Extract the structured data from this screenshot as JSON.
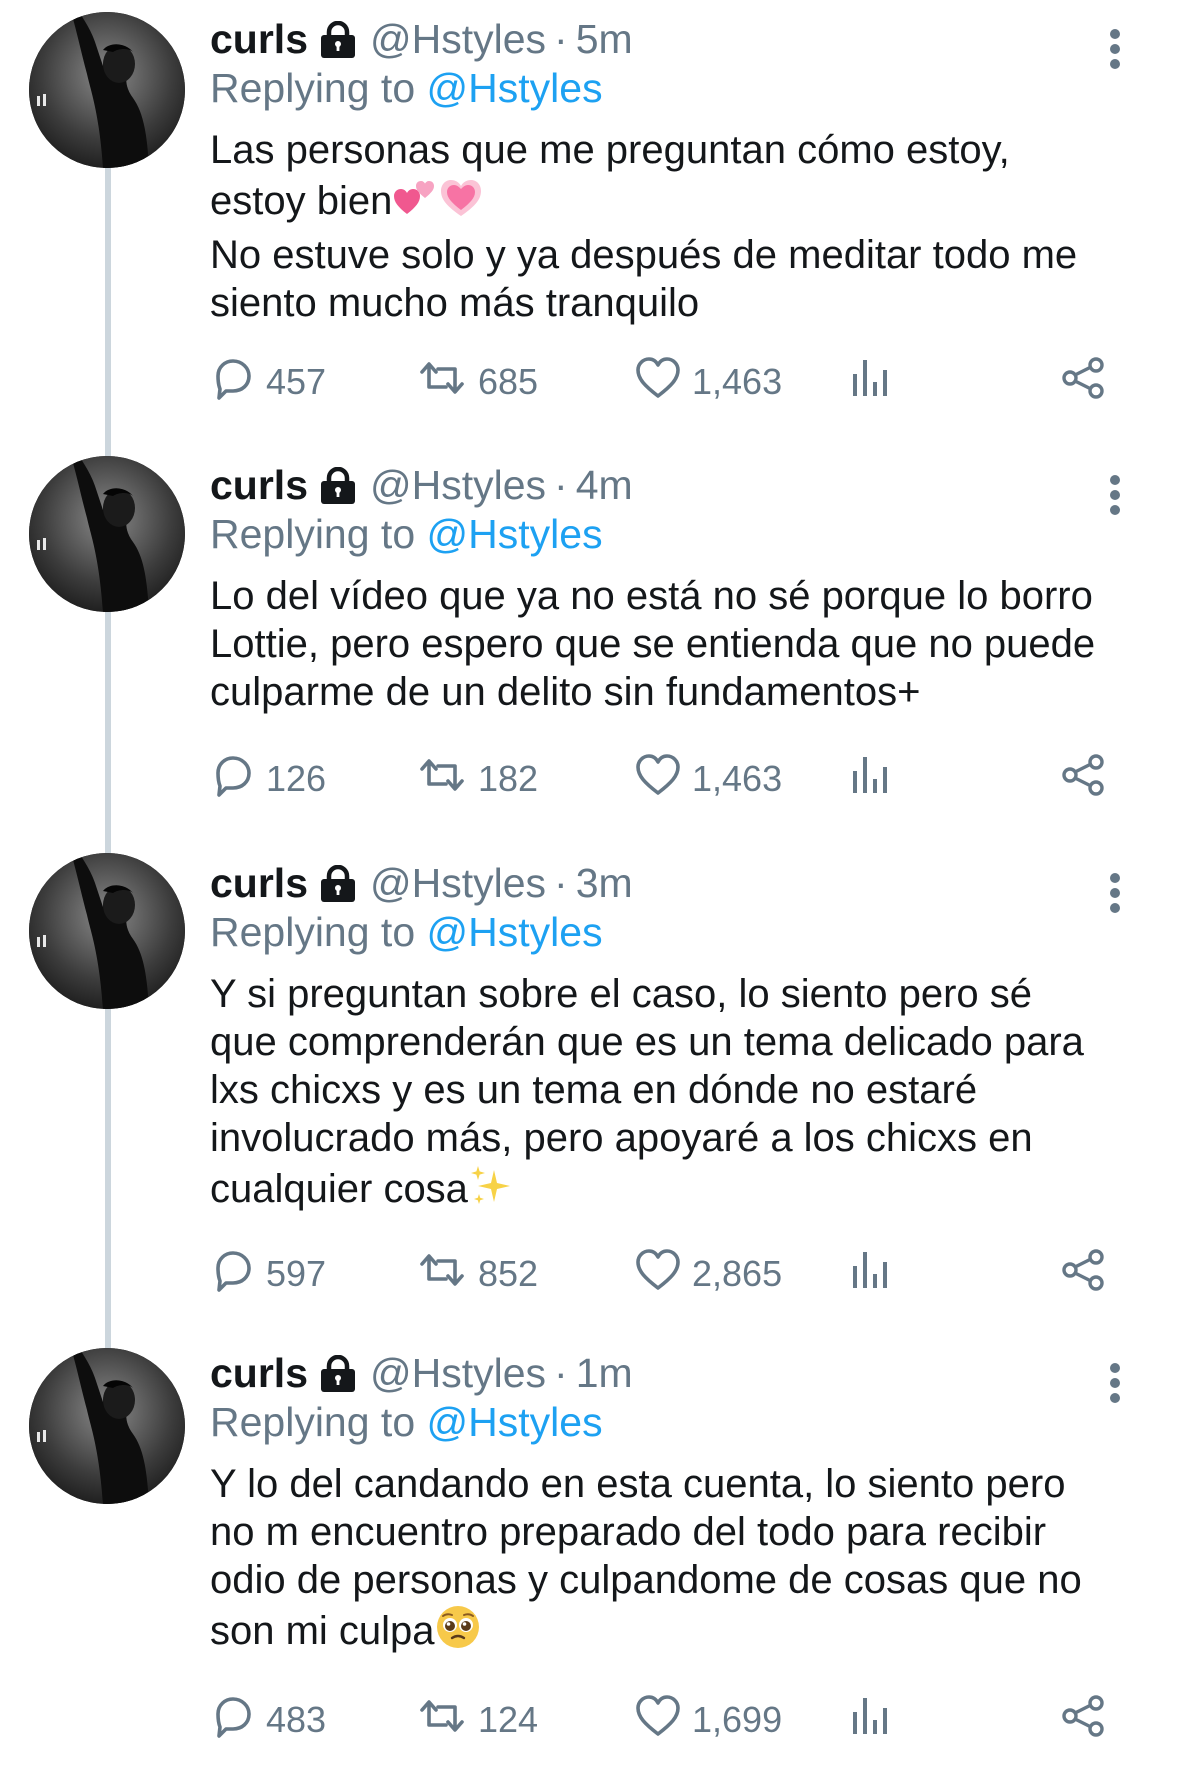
{
  "tweets": [
    {
      "name": "curls",
      "handle": "@Hstyles",
      "separator": "·",
      "time": "5m",
      "replying_prefix": "Replying to",
      "replying_to": "@Hstyles",
      "lines": [
        "Las personas que me preguntan cómo estoy,",
        "estoy bien",
        "No estuve solo y ya después de meditar todo me",
        "siento mucho más tranquilo"
      ],
      "emoji_after_line": {
        "1": [
          "two-hearts-emoji",
          "growing-heart-emoji"
        ]
      },
      "replies": "457",
      "retweets": "685",
      "likes": "1,463"
    },
    {
      "name": "curls",
      "handle": "@Hstyles",
      "separator": "·",
      "time": "4m",
      "replying_prefix": "Replying to",
      "replying_to": "@Hstyles",
      "lines": [
        "Lo del vídeo que ya no está no sé porque lo borro",
        "Lottie, pero espero que se entienda que no puede",
        "culparme de un delito sin fundamentos+"
      ],
      "emoji_after_line": {},
      "replies": "126",
      "retweets": "182",
      "likes": "1,463"
    },
    {
      "name": "curls",
      "handle": "@Hstyles",
      "separator": "·",
      "time": "3m",
      "replying_prefix": "Replying to",
      "replying_to": "@Hstyles",
      "lines": [
        "Y si preguntan sobre el caso, lo siento pero sé",
        "que comprenderán que es un tema delicado para",
        "lxs chicxs y es un tema en dónde no estaré",
        "involucrado más, pero apoyaré a los chicxs en",
        "cualquier cosa"
      ],
      "emoji_after_line": {
        "4": [
          "sparkles-emoji"
        ]
      },
      "replies": "597",
      "retweets": "852",
      "likes": "2,865"
    },
    {
      "name": "curls",
      "handle": "@Hstyles",
      "separator": "·",
      "time": "1m",
      "replying_prefix": "Replying to",
      "replying_to": "@Hstyles",
      "lines": [
        "Y lo del candando en esta cuenta, lo siento pero",
        "no m encuentro preparado del todo para recibir",
        "odio de personas y culpandome de cosas que no",
        "son mi culpa"
      ],
      "emoji_after_line": {
        "3": [
          "pleading-face-emoji"
        ]
      },
      "replies": "483",
      "retweets": "124",
      "likes": "1,699"
    }
  ],
  "icons": {
    "protected": "lock-icon",
    "more": "more-vertical-icon",
    "reply": "reply-icon",
    "retweet": "retweet-icon",
    "like": "heart-icon",
    "analytics": "analytics-icon",
    "share": "share-icon"
  },
  "colors": {
    "mention": "#1da1f2",
    "secondary_text": "#657786",
    "thread_line": "#ccd6dd"
  }
}
